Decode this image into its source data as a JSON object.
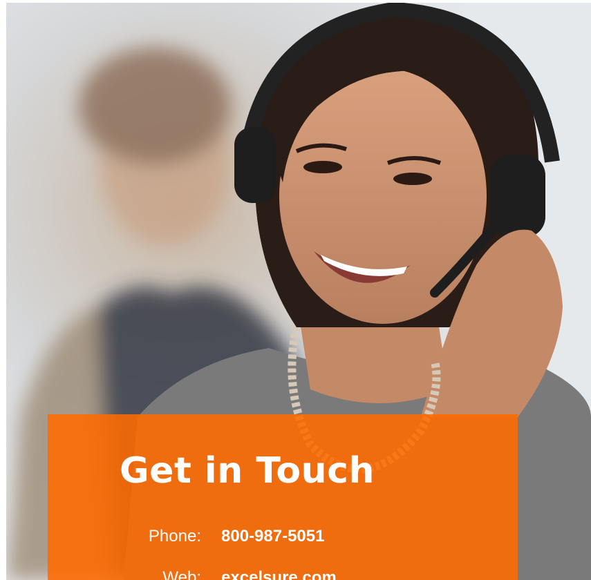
{
  "hero": {
    "image_alt": "Smiling customer support agent wearing a headset"
  },
  "contact_card": {
    "title": "Get in Touch",
    "rows": [
      {
        "label": "Phone:",
        "value": "800-987-5051"
      },
      {
        "label": "Web:",
        "value": "excelsure.com"
      }
    ]
  },
  "colors": {
    "accent": "#ff6a00",
    "text_on_accent": "#ffffff"
  }
}
